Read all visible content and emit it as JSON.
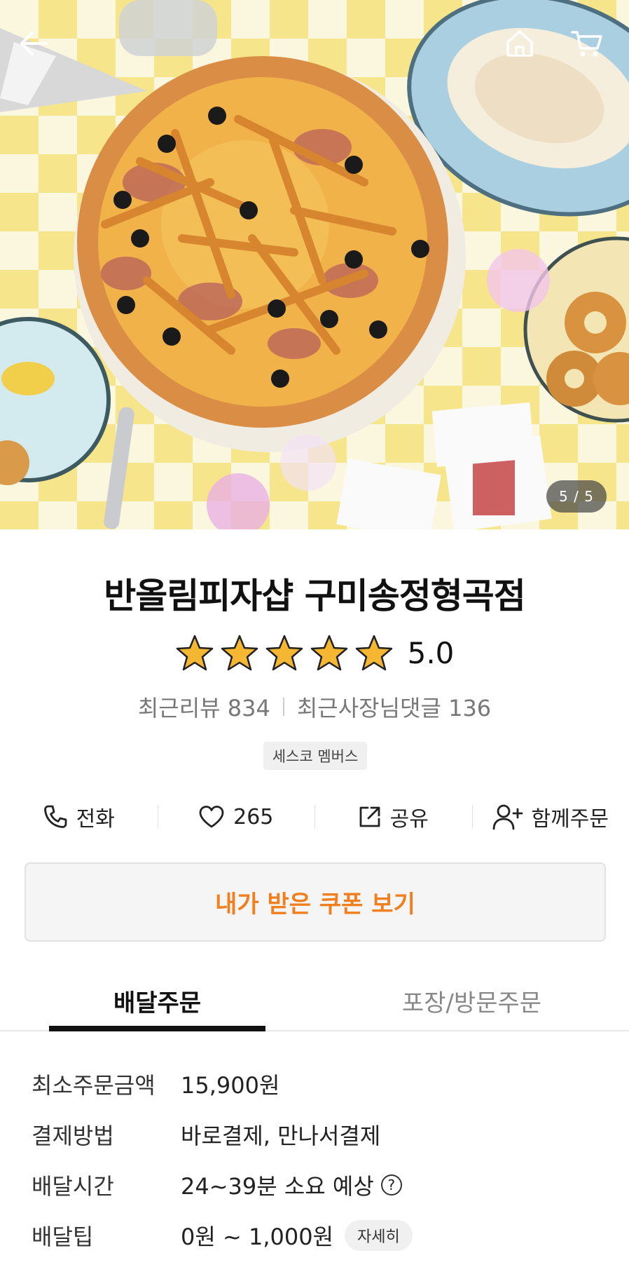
{
  "hero": {
    "counter": "5 / 5",
    "icons": [
      "back-arrow-icon",
      "home-icon",
      "cart-icon"
    ]
  },
  "store": {
    "name": "반올림피자샵 구미송정형곡점",
    "rating": "5.0",
    "stars": 5,
    "recent_reviews": "최근리뷰 834",
    "owner_replies": "최근사장님댓글 136",
    "badge": "세스코 멤버스"
  },
  "actions": {
    "call": "전화",
    "likes": "265",
    "share": "공유",
    "group_order": "함께주문"
  },
  "coupon": {
    "label": "내가 받은 쿠폰 보기"
  },
  "tabs": {
    "delivery": "배달주문",
    "pickup": "포장/방문주문"
  },
  "info": {
    "min_order_label": "최소주문금액",
    "min_order_value": "15,900원",
    "payment_label": "결제방법",
    "payment_value": "바로결제, 만나서결제",
    "time_label": "배달시간",
    "time_value": "24~39분 소요 예상",
    "tip_label": "배달팁",
    "tip_value": "0원 ~ 1,000원",
    "detail_label": "자세히"
  },
  "colors": {
    "accent": "#f07f1f",
    "star": "#f5b731",
    "checker_yellow": "#f6e58a"
  }
}
